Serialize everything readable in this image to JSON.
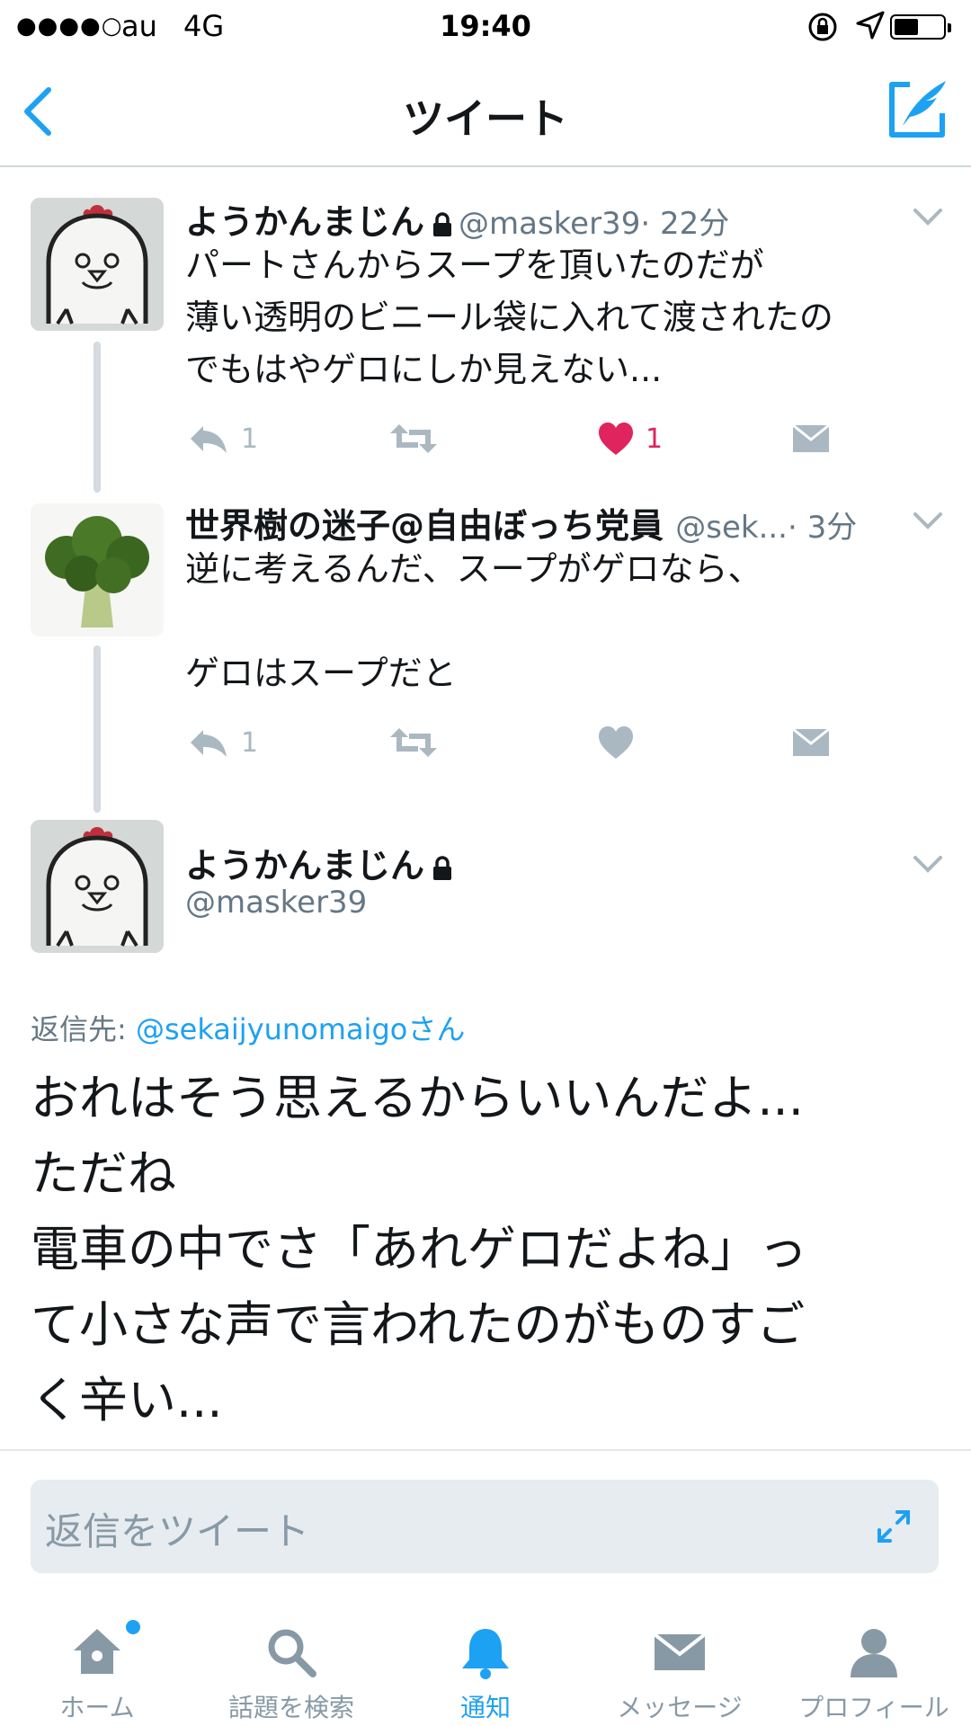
{
  "status_bar": {
    "signal": "●●●●○",
    "carrier": "au",
    "network": "4G",
    "time": "19:40"
  },
  "nav": {
    "title": "ツイート",
    "back_icon": "chevron-left-icon",
    "compose_icon": "compose-tweet-icon"
  },
  "tweets": [
    {
      "name": "ようかんまじん",
      "handle": "@masker39",
      "time": "· 22分",
      "protected": true,
      "lines": [
        "パートさんからスープを頂いたのだが",
        "薄い透明のビニール袋に入れて渡されたの",
        "でもはやゲロにしか見えない..."
      ],
      "reply_count": "1",
      "retweet_count": "",
      "like_count": "1",
      "liked": true
    },
    {
      "name": "世界樹の迷子@自由ぼっち党員",
      "handle": "@sek...",
      "time": "· 3分",
      "protected": false,
      "lines": [
        "逆に考えるんだ、スープがゲロなら、",
        "",
        "ゲロはスープだと"
      ],
      "reply_count": "1",
      "retweet_count": "",
      "like_count": "",
      "liked": false
    }
  ],
  "focused_tweet": {
    "name": "ようかんまじん",
    "handle": "@masker39",
    "reply_to_label": "返信先:",
    "reply_to_user": "@sekaijyunomaigo",
    "reply_to_suffix": "さん",
    "text": "おれはそう思えるからいいんだよ...\nただね\n電車の中でさ「あれゲロだよね」っ\nて小さな声で言われたのがものすご\nく辛い..."
  },
  "reply_box": {
    "placeholder": "返信をツイート"
  },
  "tabs": [
    {
      "label": "ホーム",
      "icon": "home-icon",
      "active": false,
      "badge": true
    },
    {
      "label": "話題を検索",
      "icon": "search-icon",
      "active": false
    },
    {
      "label": "通知",
      "icon": "bell-icon",
      "active": true
    },
    {
      "label": "メッセージ",
      "icon": "envelope-icon",
      "active": false
    },
    {
      "label": "プロフィール",
      "icon": "person-icon",
      "active": false
    }
  ],
  "colors": {
    "accent": "#1da1f2",
    "like": "#e0245e",
    "muted": "#aab8c2",
    "secondary_text": "#657786"
  }
}
